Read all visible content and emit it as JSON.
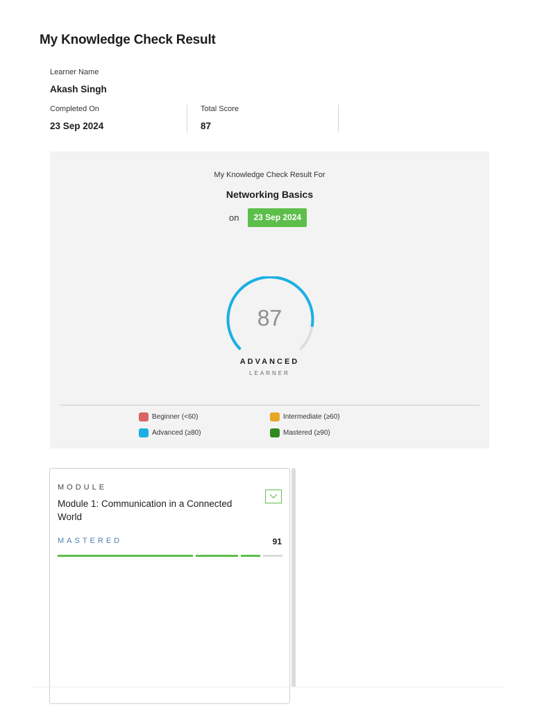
{
  "page": {
    "title": "My Knowledge Check Result"
  },
  "learner": {
    "name_label": "Learner Name",
    "name": "Akash Singh",
    "completed_label": "Completed On",
    "completed_date": "23 Sep 2024",
    "score_label": "Total Score",
    "score": "87"
  },
  "result": {
    "for_label": "My Knowledge Check Result For",
    "course": "Networking Basics",
    "on_label": "on",
    "date": "23 Sep 2024",
    "score": "87",
    "score_fraction": 0.87,
    "level": "ADVANCED",
    "level_sub": "LEARNER",
    "gauge_color": "#1ab0e4",
    "gauge_track_color": "#dedede"
  },
  "legend": [
    {
      "label": "Beginner (<60)",
      "color": "#d96464"
    },
    {
      "label": "Intermediate (≥60)",
      "color": "#e9a623"
    },
    {
      "label": "Advanced (≥80)",
      "color": "#1ab0e4"
    },
    {
      "label": "Mastered (≥90)",
      "color": "#2f8a1e"
    }
  ],
  "module": {
    "eyebrow": "MODULE",
    "title": "Module 1: Communication in a Connected World",
    "toggle_icon": "chevron-down-icon",
    "status": "MASTERED",
    "score": "91",
    "progress_fraction": 0.91,
    "progress_color": "#5cbf4a",
    "progress_track_color": "#dcdcdc"
  }
}
